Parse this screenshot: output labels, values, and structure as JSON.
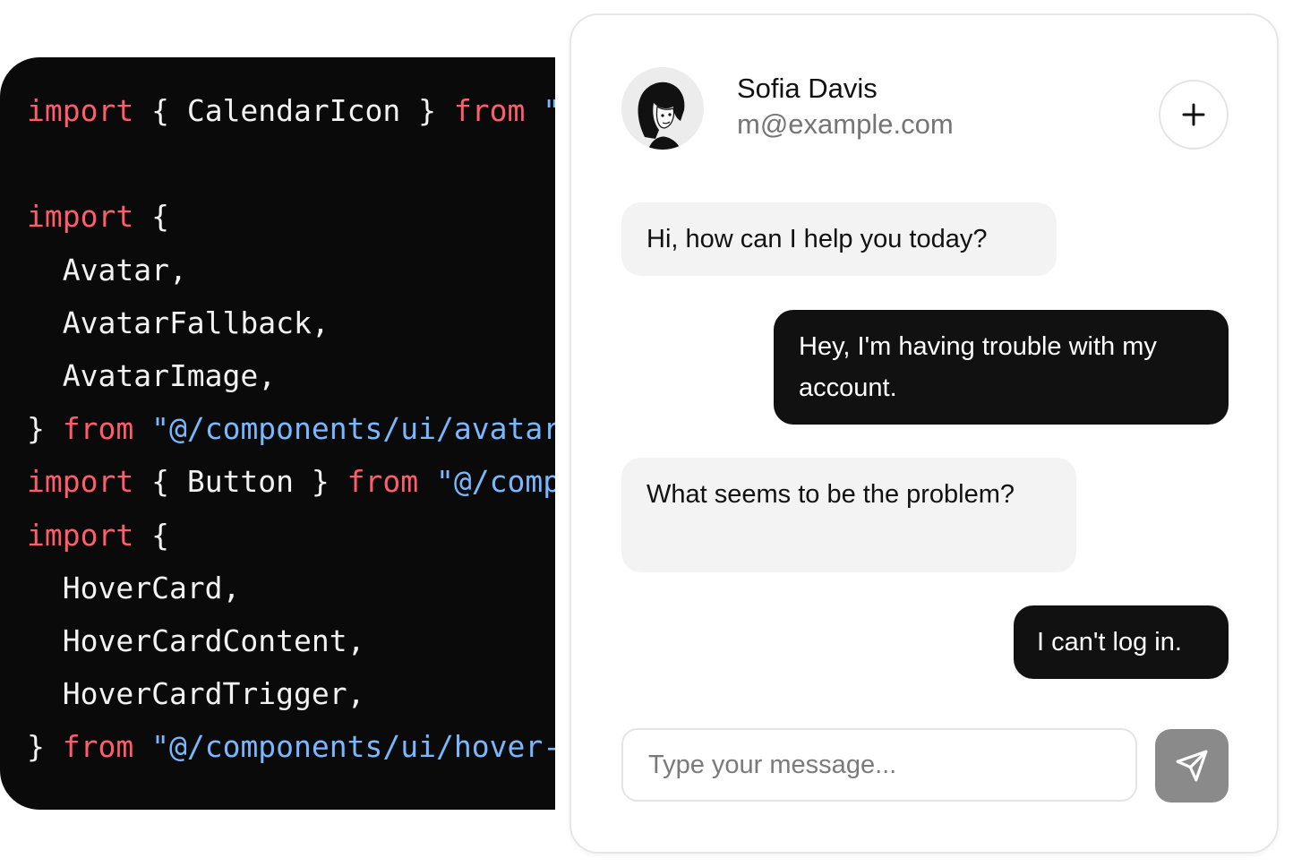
{
  "code": {
    "lines": [
      [
        {
          "t": "kw",
          "v": "import"
        },
        {
          "t": "pun",
          "v": " { "
        },
        {
          "t": "id",
          "v": "CalendarIcon"
        },
        {
          "t": "pun",
          "v": " } "
        },
        {
          "t": "kw",
          "v": "from"
        },
        {
          "t": "str",
          "v": " \"@/components/ui/calendar-icon\""
        }
      ],
      [],
      [
        {
          "t": "kw",
          "v": "import"
        },
        {
          "t": "pun",
          "v": " {"
        }
      ],
      [
        {
          "t": "id",
          "v": "  Avatar,"
        }
      ],
      [
        {
          "t": "id",
          "v": "  AvatarFallback,"
        }
      ],
      [
        {
          "t": "id",
          "v": "  AvatarImage,"
        }
      ],
      [
        {
          "t": "pun",
          "v": "} "
        },
        {
          "t": "kw",
          "v": "from"
        },
        {
          "t": "str",
          "v": " \"@/components/ui/avatar\""
        }
      ],
      [
        {
          "t": "kw",
          "v": "import"
        },
        {
          "t": "pun",
          "v": " { "
        },
        {
          "t": "id",
          "v": "Button"
        },
        {
          "t": "pun",
          "v": " } "
        },
        {
          "t": "kw",
          "v": "from"
        },
        {
          "t": "str",
          "v": " \"@/components/ui/button\""
        }
      ],
      [
        {
          "t": "kw",
          "v": "import"
        },
        {
          "t": "pun",
          "v": " {"
        }
      ],
      [
        {
          "t": "id",
          "v": "  HoverCard,"
        }
      ],
      [
        {
          "t": "id",
          "v": "  HoverCardContent,"
        }
      ],
      [
        {
          "t": "id",
          "v": "  HoverCardTrigger,"
        }
      ],
      [
        {
          "t": "pun",
          "v": "} "
        },
        {
          "t": "kw",
          "v": "from"
        },
        {
          "t": "str",
          "v": " \"@/components/ui/hover-card\""
        }
      ]
    ]
  },
  "chat": {
    "user": {
      "name": "Sofia Davis",
      "email": "m@example.com"
    },
    "add_icon": "plus-icon",
    "messages": [
      {
        "role": "agent",
        "text": "Hi, how can I help you today?"
      },
      {
        "role": "user",
        "text": "Hey, I'm having trouble with my account."
      },
      {
        "role": "agent",
        "text": "What seems to be the problem?"
      },
      {
        "role": "user",
        "text": "I can't log in."
      }
    ],
    "composer": {
      "placeholder": "Type your message...",
      "value": ""
    },
    "send_icon": "send-icon"
  },
  "colors": {
    "code_bg": "#0a0a0b",
    "keyword": "#ff5d6c",
    "string": "#79b8ff",
    "user_bubble": "#111111",
    "agent_bubble": "#f3f3f3",
    "send_button": "#8a8a8a"
  }
}
